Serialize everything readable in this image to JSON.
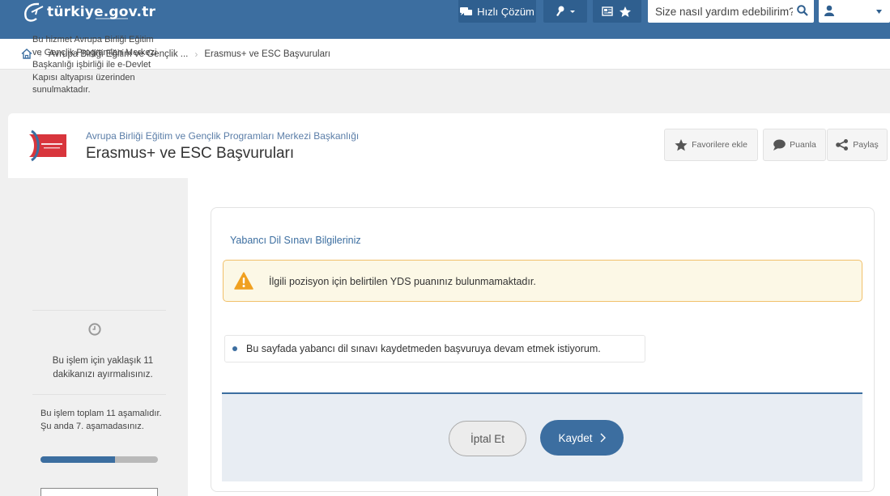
{
  "topbar": {
    "logo_text": "türkiye.gov.tr",
    "quick_solution_label": "Hızlı Çözüm",
    "search_placeholder": "Size nasıl yardım edebilirim?"
  },
  "breadcrumb": [
    "Avrupa Birliği Eğitim ve Gençlik ...",
    "Erasmus+ ve ESC Başvuruları"
  ],
  "header": {
    "institution": "Avrupa Birliği Eğitim ve Gençlik Programları Merkezi Başkanlığı",
    "service_title": "Erasmus+ ve ESC Başvuruları",
    "favorite_label": "Favorilere ekle",
    "rate_label": "Puanla",
    "share_label": "Paylaş"
  },
  "sidebar": {
    "intro": "Bu hizmet Avrupa Birliği Eğitim ve Gençlik Programları Merkezi Başkanlığı işbirliği ile e-Devlet Kapısı altyapısı üzerinden sunulmaktadır.",
    "time_note": "Bu işlem için yaklaşık 11 dakikanızı ayırmalısınız.",
    "steps_note": "Bu işlem toplam 11 aşamalıdır. Şu anda 7. aşamadasınız.",
    "progress_fraction": 0.636
  },
  "main": {
    "section_title": "Yabancı Dil Sınavı Bilgileriniz",
    "alert_text": "İlgili pozisyon için belirtilen YDS puanınız bulunmamaktadır.",
    "option_label": "Bu sayfada yabancı dil sınavı kaydetmeden başvuruya devam etmek istiyorum.",
    "cancel_label": "İptal Et",
    "save_label": "Kaydet"
  },
  "colors": {
    "brand_blue": "#3c6ea0",
    "alert_border": "#f1c06a",
    "alert_bg": "#fcf8e6",
    "warning_icon": "#f0a020"
  }
}
